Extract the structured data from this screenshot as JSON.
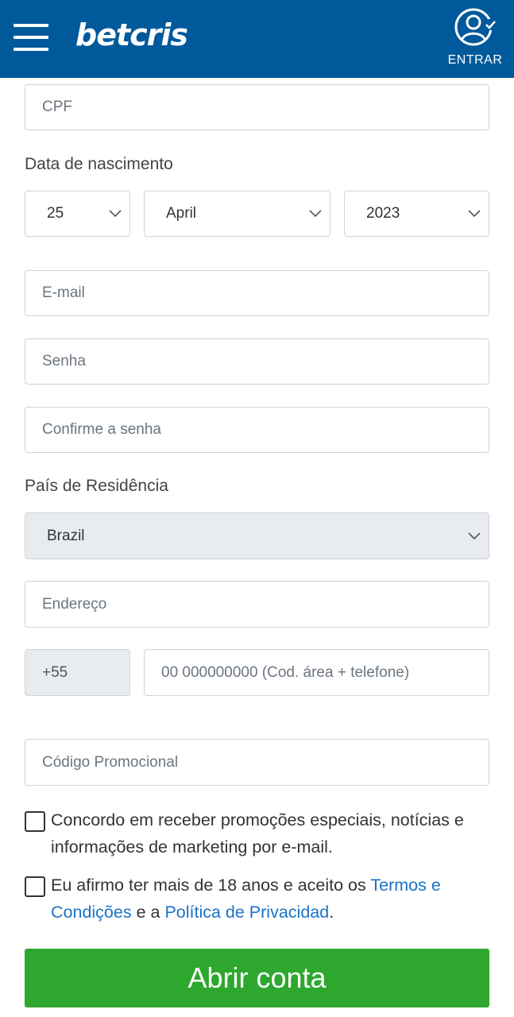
{
  "header": {
    "logo_text": "betcris",
    "login_label": "ENTRAR",
    "background_color": "#00599b"
  },
  "form": {
    "cpf_placeholder": "CPF",
    "birthdate_label": "Data de nascimento",
    "birth_day": "25",
    "birth_month": "April",
    "birth_year": "2023",
    "email_placeholder": "E-mail",
    "password_placeholder": "Senha",
    "confirm_password_placeholder": "Confirme a senha",
    "country_label": "País de Residência",
    "country_value": "Brazil",
    "address_placeholder": "Endereço",
    "phone_prefix": "+55",
    "phone_placeholder": "00 000000000 (Cod. área + telefone)",
    "promo_placeholder": "Código Promocional",
    "marketing_consent": "Concordo em receber promoções especiais, notícias e informações de marketing por e-mail.",
    "age_text_1": "Eu afirmo ter mais de 18 anos e aceito os ",
    "terms_link": "Termos e Condições",
    "age_text_2": " e a ",
    "privacy_link": "Política de Privacidad",
    "age_text_3": ".",
    "submit_label": "Abrir conta"
  },
  "colors": {
    "primary": "#00599b",
    "button_green": "#2ea72e",
    "link_blue": "#1a73c8"
  },
  "icons": [
    "menu-icon",
    "user-check-icon",
    "chevron-down-icon"
  ]
}
